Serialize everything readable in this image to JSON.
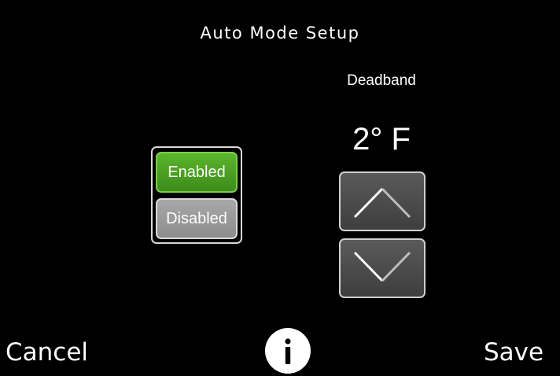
{
  "header": {
    "title": "Auto Mode Setup"
  },
  "auto_mode": {
    "enabled_label": "Enabled",
    "disabled_label": "Disabled",
    "selected": "Enabled"
  },
  "deadband": {
    "label": "Deadband",
    "value": "2° F"
  },
  "icons": {
    "up": "chevron-up-icon",
    "down": "chevron-down-icon",
    "info": "info-icon"
  },
  "footer": {
    "cancel_label": "Cancel",
    "save_label": "Save"
  },
  "colors": {
    "background": "#000000",
    "enabled": "#4a9f22",
    "disabled": "#9a9a9a",
    "arrow_button": "#4a4a4a"
  }
}
